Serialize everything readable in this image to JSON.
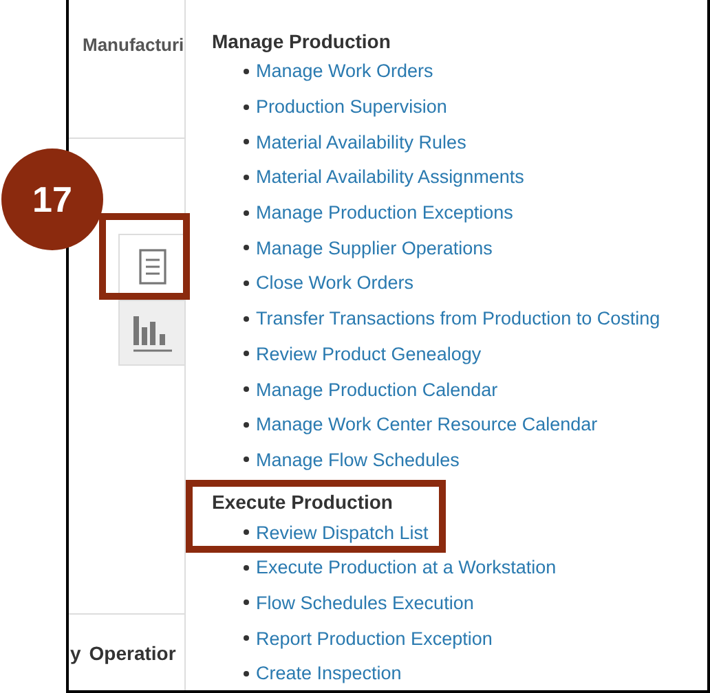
{
  "step_badge": "17",
  "side_rail": {
    "title": "Manufacturi",
    "tabs": [
      {
        "kind": "document",
        "selected": true
      },
      {
        "kind": "chart",
        "selected": false
      }
    ],
    "columns": [
      "y",
      "Operatior"
    ]
  },
  "menu": {
    "sections": [
      {
        "title": "Manage Production",
        "highlighted": false,
        "items": [
          "Manage Work Orders",
          "Production Supervision",
          "Material Availability Rules",
          "Material Availability Assignments",
          "Manage Production Exceptions",
          "Manage Supplier Operations",
          "Close Work Orders",
          "Transfer Transactions from Production to Costing",
          "Review Product Genealogy",
          "Manage Production Calendar",
          "Manage Work Center Resource Calendar",
          "Manage Flow Schedules"
        ]
      },
      {
        "title": "Execute Production",
        "highlighted": true,
        "items": [
          "Review Dispatch List",
          "Execute Production at a Workstation",
          "Flow Schedules Execution",
          "Report Production Exception",
          "Create Inspection"
        ]
      }
    ]
  }
}
